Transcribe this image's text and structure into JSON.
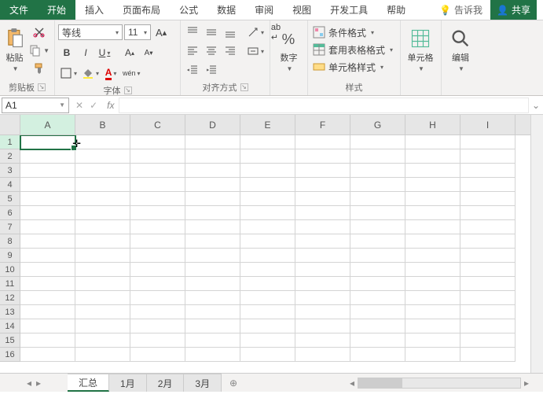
{
  "tabs": {
    "file": "文件",
    "start": "开始",
    "insert": "插入",
    "layout": "页面布局",
    "formula": "公式",
    "data": "数据",
    "review": "审阅",
    "view": "视图",
    "dev": "开发工具",
    "help": "帮助",
    "tellme": "告诉我",
    "share": "共享"
  },
  "ribbon": {
    "clipboard": {
      "paste": "粘贴",
      "label": "剪贴板"
    },
    "font": {
      "name": "等线",
      "size": "11",
      "label": "字体"
    },
    "align": {
      "label": "对齐方式"
    },
    "number": {
      "btn": "数字",
      "label": "数字"
    },
    "styles": {
      "cond": "条件格式",
      "table": "套用表格格式",
      "cell": "单元格样式",
      "label": "样式"
    },
    "cells": {
      "btn": "单元格"
    },
    "edit": {
      "btn": "编辑"
    }
  },
  "namebox": "A1",
  "cols": [
    "A",
    "B",
    "C",
    "D",
    "E",
    "F",
    "G",
    "H",
    "I"
  ],
  "rows": [
    "1",
    "2",
    "3",
    "4",
    "5",
    "6",
    "7",
    "8",
    "9",
    "10",
    "11",
    "12",
    "13",
    "14",
    "15",
    "16"
  ],
  "sheets": {
    "active": "汇总",
    "s1": "1月",
    "s2": "2月",
    "s3": "3月"
  }
}
